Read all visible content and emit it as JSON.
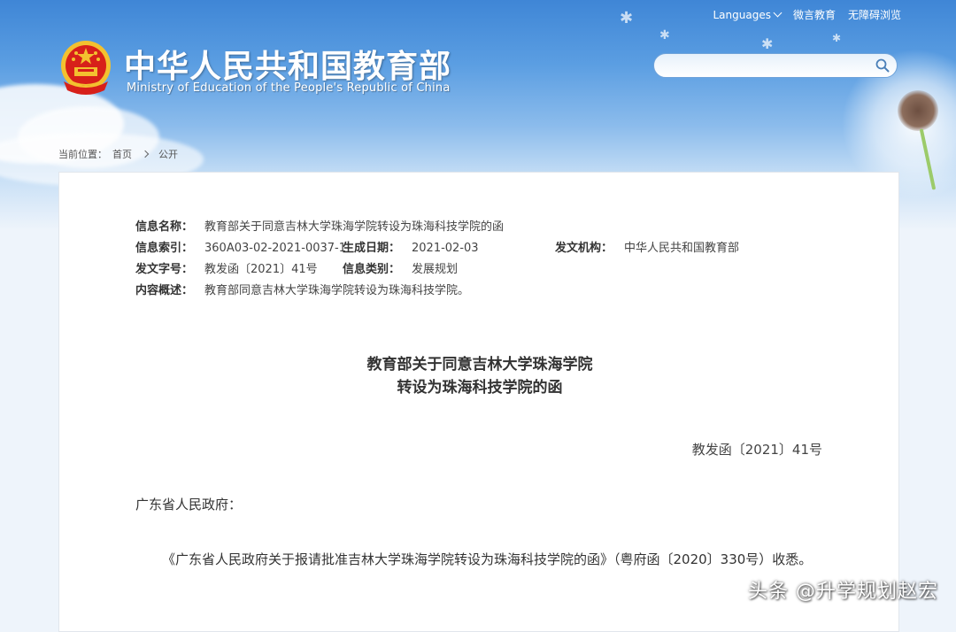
{
  "header": {
    "languages_label": "Languages",
    "weibo_label": "微言教育",
    "accessibility_label": "无障碍浏览",
    "title": "中华人民共和国教育部",
    "subtitle": "Ministry of Education of the People's Republic of China",
    "search": {
      "placeholder": "",
      "value": ""
    }
  },
  "breadcrumb": {
    "prefix": "当前位置：",
    "home": "首页",
    "current": "公开"
  },
  "meta": {
    "name_label": "信息名称：",
    "name_value": "教育部关于同意吉林大学珠海学院转设为珠海科技学院的函",
    "index_label": "信息索引：",
    "index_value": "360A03-02-2021-0037-1",
    "date_label": "生成日期：",
    "date_value": "2021-02-03",
    "org_label": "发文机构：",
    "org_value": "中华人民共和国教育部",
    "docno_label": "发文字号：",
    "docno_value": "教发函〔2021〕41号",
    "category_label": "信息类别：",
    "category_value": "发展规划",
    "summary_label": "内容概述：",
    "summary_value": "教育部同意吉林大学珠海学院转设为珠海科技学院。"
  },
  "document": {
    "title_line1": "教育部关于同意吉林大学珠海学院",
    "title_line2": "转设为珠海科技学院的函",
    "number": "教发函〔2021〕41号",
    "addressee": "广东省人民政府：",
    "body": "《广东省人民政府关于报请批准吉林大学珠海学院转设为珠海科技学院的函》（粤府函〔2020〕330号）收悉。"
  },
  "watermark": "头条 @升学规划赵宏",
  "colors": {
    "sky_top": "#3f86d6",
    "emblem_red": "#d7201a",
    "emblem_gold": "#f3c12f"
  }
}
